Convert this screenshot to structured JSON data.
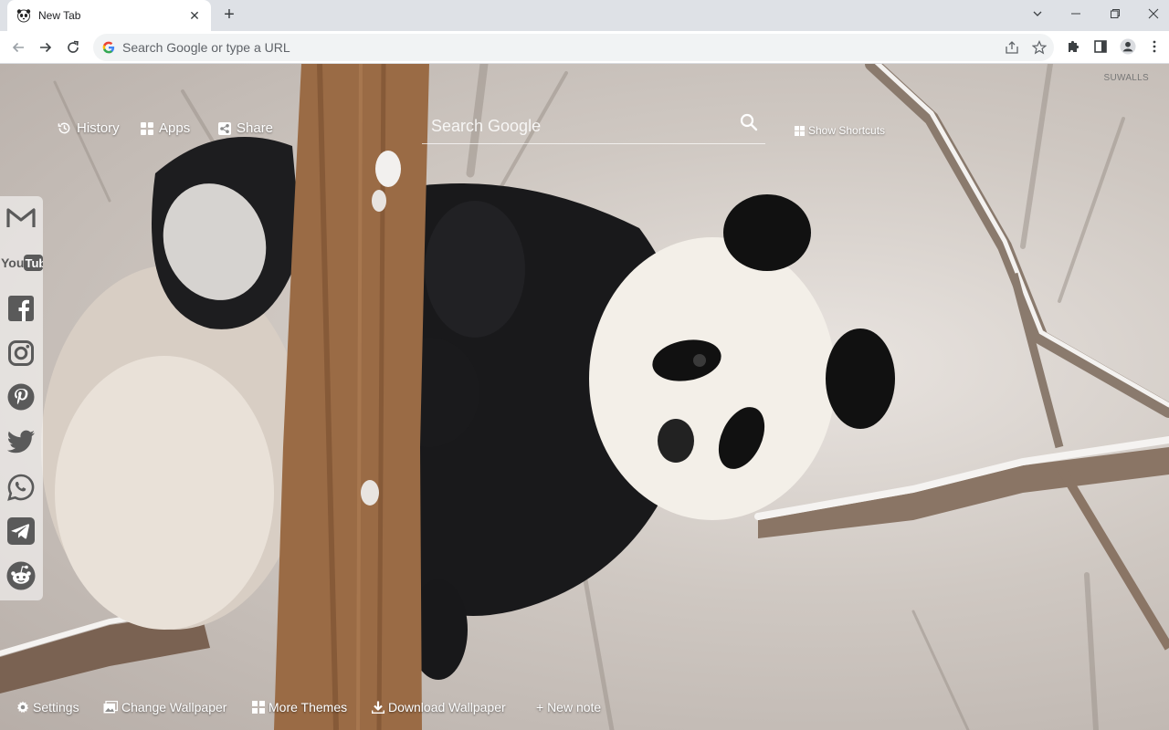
{
  "browser": {
    "tab": {
      "title": "New Tab"
    },
    "omnibox": {
      "placeholder": "Search Google or type a URL"
    }
  },
  "page": {
    "brand": "SUWALLS",
    "nav": {
      "history": "History",
      "apps": "Apps",
      "share": "Share"
    },
    "search": {
      "placeholder": "Search Google"
    },
    "show_shortcuts": "Show Shortcuts",
    "footer": {
      "settings": "Settings",
      "change_wallpaper": "Change Wallpaper",
      "more_themes": "More Themes",
      "download_wallpaper": "Download Wallpaper",
      "new_note": "+ New note"
    },
    "social": [
      "gmail-icon",
      "youtube-icon",
      "facebook-icon",
      "instagram-icon",
      "pinterest-icon",
      "twitter-icon",
      "whatsapp-icon",
      "telegram-icon",
      "reddit-icon"
    ]
  },
  "colors": {
    "tabbar": "#dee1e6",
    "social_icon": "#5a5a5a",
    "text_white": "#ffffff"
  }
}
